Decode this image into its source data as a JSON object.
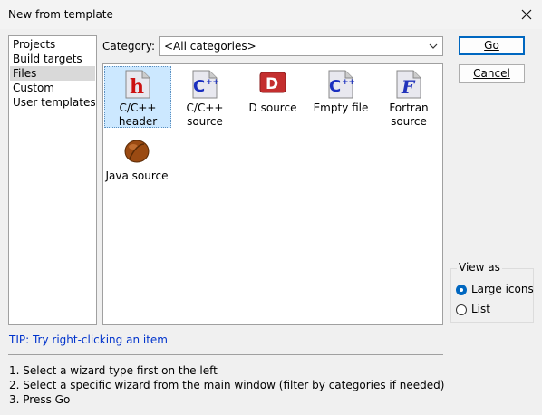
{
  "window": {
    "title": "New from template"
  },
  "left_list": {
    "items": [
      "Projects",
      "Build targets",
      "Files",
      "Custom",
      "User templates"
    ],
    "selected": "Files"
  },
  "category": {
    "label": "Category:",
    "value": "<All categories>"
  },
  "buttons": {
    "go": "Go",
    "cancel": "Cancel"
  },
  "templates": [
    {
      "label": "C/C++ header",
      "icon": "cpp-header-icon",
      "selected": true
    },
    {
      "label": "C/C++ source",
      "icon": "cpp-source-icon",
      "selected": false
    },
    {
      "label": "D source",
      "icon": "d-source-icon",
      "selected": false
    },
    {
      "label": "Empty file",
      "icon": "empty-file-icon",
      "selected": false
    },
    {
      "label": "Fortran source",
      "icon": "fortran-source-icon",
      "selected": false
    },
    {
      "label": "Java source",
      "icon": "java-source-icon",
      "selected": false
    }
  ],
  "view_as": {
    "label": "View as",
    "options": [
      "Large icons",
      "List"
    ],
    "selected": "Large icons"
  },
  "tip": "TIP: Try right-clicking an item",
  "instructions": [
    "1. Select a wizard type first on the left",
    "2. Select a specific wizard from the main window (filter by categories if needed)",
    "3. Press Go"
  ],
  "colors": {
    "accent": "#0067c0",
    "tip": "#0033cc",
    "selection": "#cce8ff"
  }
}
